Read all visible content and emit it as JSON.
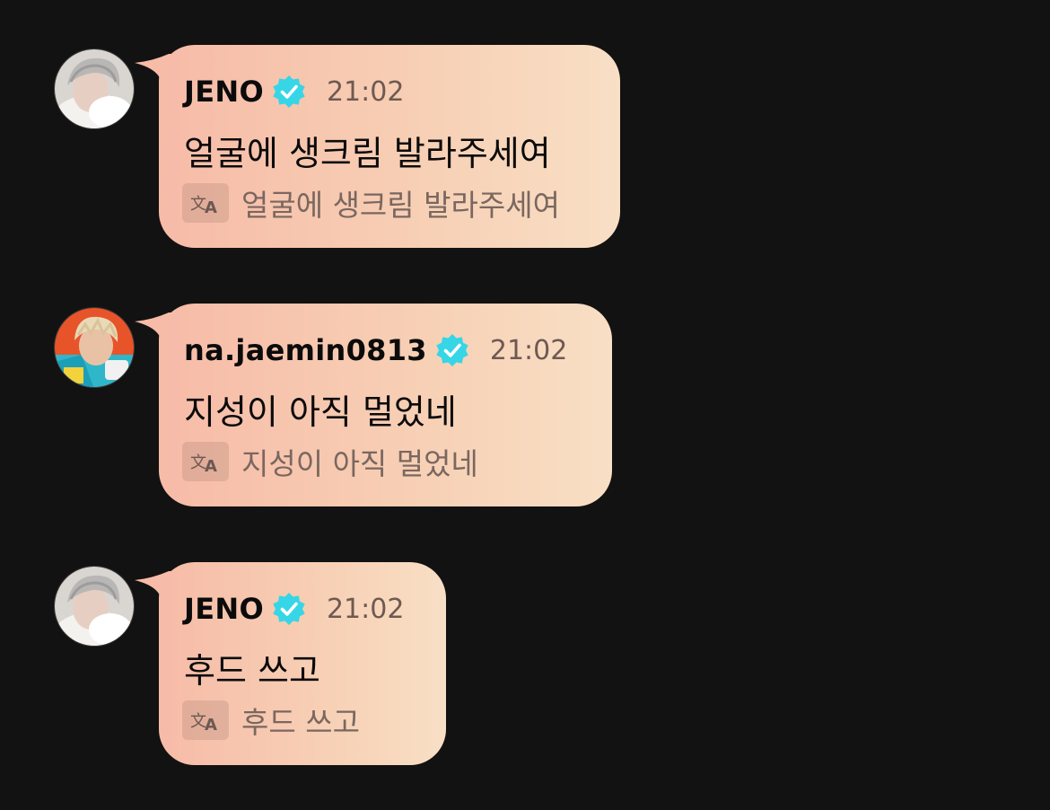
{
  "messages": [
    {
      "author": "JENO",
      "verified": true,
      "time": "21:02",
      "text": "얼굴에 생크림 발라주세여",
      "translation": "얼굴에 생크림 발라주세여",
      "avatar": "avatar-jeno"
    },
    {
      "author": "na.jaemin0813",
      "verified": true,
      "time": "21:02",
      "text": "지성이 아직 멀었네",
      "translation": "지성이 아직 멀었네",
      "avatar": "avatar-jaemin"
    },
    {
      "author": "JENO",
      "verified": true,
      "time": "21:02",
      "text": "후드 쓰고",
      "translation": "후드 쓰고",
      "avatar": "avatar-jeno"
    }
  ],
  "icons": {
    "verified": "verified-badge-icon",
    "translate": "translate-icon"
  },
  "colors": {
    "background": "#121212",
    "bubble_start": "#f7bba8",
    "bubble_end": "#f8dfc5",
    "verified": "#36d6e7"
  }
}
